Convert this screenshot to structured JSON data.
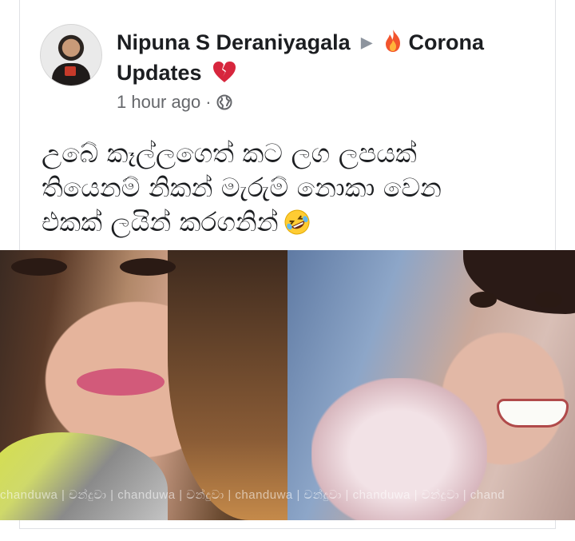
{
  "post": {
    "author": "Nipuna S Deraniyagala",
    "group_name": "Corona Updates",
    "timestamp": "1 hour ago",
    "separator": "·",
    "privacy_icon": "globe-icon",
    "text_lines": [
      "උබේ කෑල්ලගෙත් කට ලග ලපයක්",
      "තියෙනම් නිකන් මැරුම් නොකා වෙන",
      "එකක් ලයින් කරගනින්"
    ],
    "emojis": {
      "group_prefix": "fire-emoji",
      "group_suffix": "broken-heart-emoji",
      "text_suffix": "rolling-on-floor-laughing-emoji"
    }
  },
  "photo": {
    "watermark": "chanduwa | චන්දුවා | chanduwa | චන්දුවා | chanduwa | චන්දුවා | chanduwa | චන්දුවා | chand"
  },
  "colors": {
    "text_primary": "#1c1e21",
    "text_secondary": "#65676b",
    "arrow": "#8d949e"
  }
}
